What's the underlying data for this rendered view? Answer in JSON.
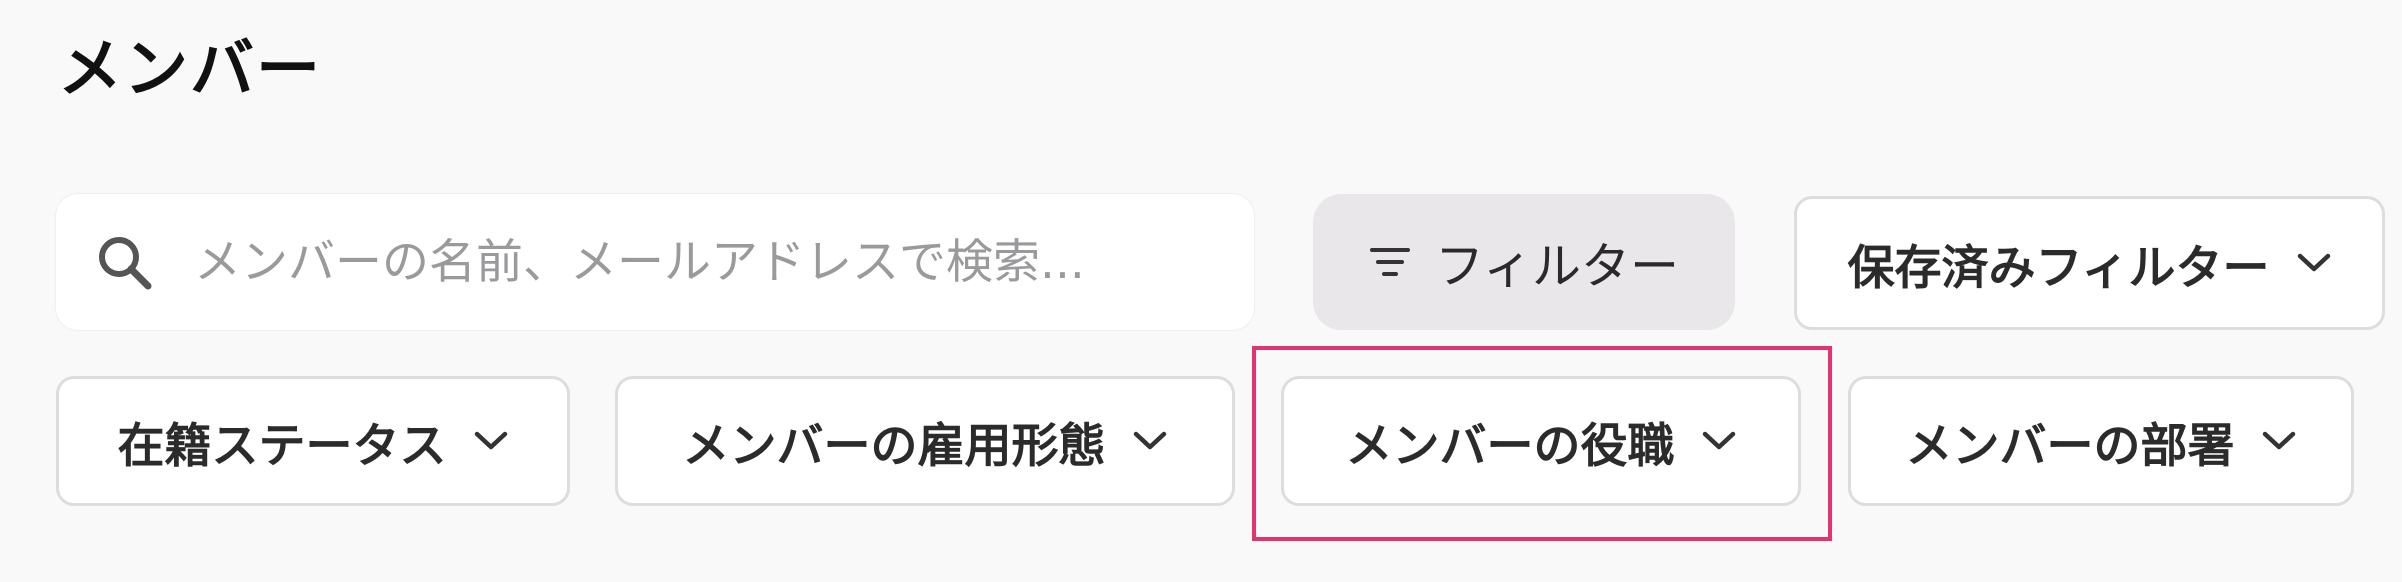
{
  "header": {
    "title": "メンバー"
  },
  "search": {
    "placeholder": "メンバーの名前、メールアドレスで検索..."
  },
  "toolbar": {
    "filter_label": "フィルター",
    "saved_filters_label": "保存済みフィルター"
  },
  "filters": [
    {
      "label": "在籍ステータス"
    },
    {
      "label": "メンバーの雇用形態"
    },
    {
      "label": "メンバーの役職"
    },
    {
      "label": "メンバーの部署"
    }
  ],
  "colors": {
    "background": "#faf9fa",
    "highlight_border": "#e0356f",
    "filter_button_bg": "#eae7ea",
    "chip_border": "#dedcde"
  },
  "icons": {
    "search": "search-icon",
    "filter": "filter-lines-icon",
    "dropdown": "chevron-down-icon"
  }
}
